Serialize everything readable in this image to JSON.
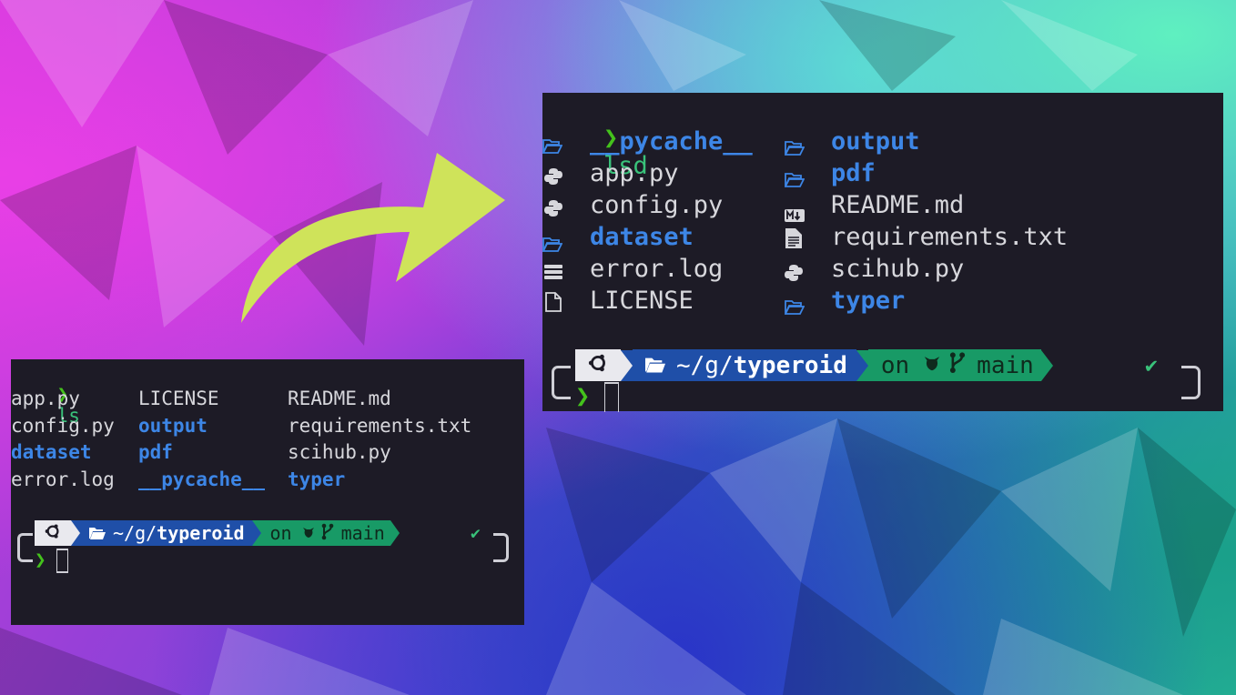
{
  "colors": {
    "terminal_bg": "#1d1b26",
    "directory": "#3d86e6",
    "prompt": "#44c21c",
    "path_segment": "#1f4fa8",
    "git_segment": "#189a66",
    "arrow": "#cfe35a"
  },
  "small_terminal": {
    "prompt_symbol": "❯",
    "command": "ls",
    "columns": [
      [
        "app.py",
        "config.py",
        "dataset",
        "error.log"
      ],
      [
        "LICENSE",
        "output",
        "pdf",
        "__pycache__"
      ],
      [
        "README.md",
        "requirements.txt",
        "scihub.py",
        "typer"
      ]
    ],
    "status": {
      "os_icon": "ubuntu-icon",
      "folder_icon": "folder-open-icon",
      "path_prefix": "~/g/",
      "path_current": "typeroid",
      "git_on": "on",
      "git_icon": "github-icon",
      "branch_icon": "git-branch-icon",
      "branch": "main",
      "ok": "✔"
    }
  },
  "large_terminal": {
    "prompt_symbol": "❯",
    "command": "lsd",
    "left_entries": [
      {
        "name": "__pycache__",
        "type": "dir",
        "icon": "folder-icon"
      },
      {
        "name": "app.py",
        "type": "file",
        "icon": "python-icon"
      },
      {
        "name": "config.py",
        "type": "file",
        "icon": "python-icon"
      },
      {
        "name": "dataset",
        "type": "dir",
        "icon": "folder-icon"
      },
      {
        "name": "error.log",
        "type": "file",
        "icon": "log-icon"
      },
      {
        "name": "LICENSE",
        "type": "file",
        "icon": "file-icon"
      }
    ],
    "right_entries": [
      {
        "name": "output",
        "type": "dir",
        "icon": "folder-icon"
      },
      {
        "name": "pdf",
        "type": "dir",
        "icon": "folder-icon"
      },
      {
        "name": "README.md",
        "type": "file",
        "icon": "markdown-icon"
      },
      {
        "name": "requirements.txt",
        "type": "file",
        "icon": "text-file-icon"
      },
      {
        "name": "scihub.py",
        "type": "file",
        "icon": "python-icon"
      },
      {
        "name": "typer",
        "type": "dir",
        "icon": "folder-icon"
      }
    ],
    "status": {
      "os_icon": "ubuntu-icon",
      "folder_icon": "folder-open-icon",
      "path_prefix": "~/g/",
      "path_current": "typeroid",
      "git_on": "on",
      "git_icon": "github-icon",
      "branch_icon": "git-branch-icon",
      "branch": "main",
      "ok": "✔"
    }
  }
}
